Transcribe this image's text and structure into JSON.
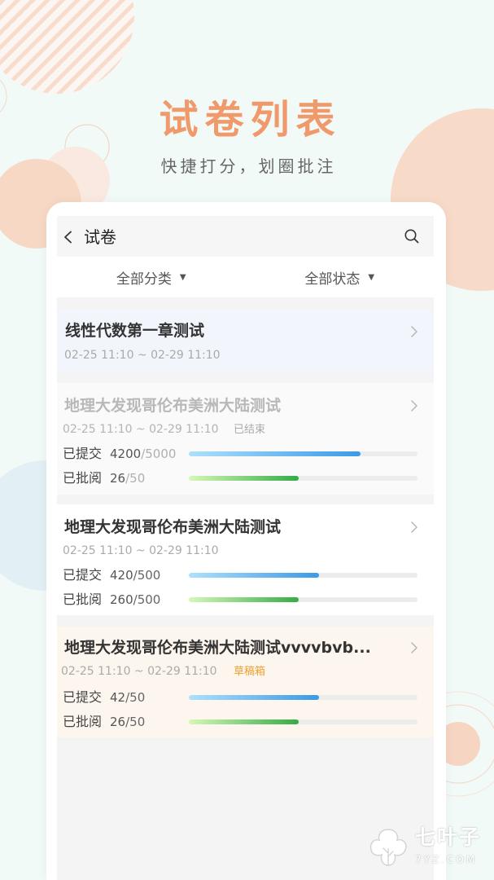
{
  "promo": {
    "title": "试卷列表",
    "subtitle": "快捷打分，划圈批注"
  },
  "header": {
    "back_icon": "chevron-left-icon",
    "title": "试卷",
    "search_icon": "search-icon"
  },
  "filters": {
    "category": {
      "label": "全部分类",
      "caret": "▼"
    },
    "status": {
      "label": "全部状态",
      "caret": "▼"
    }
  },
  "exams": [
    {
      "title": "线性代数第一章测试",
      "date_range": "02-25 11:10 ~ 02-29 11:10",
      "chevron_icon": "chevron-right-icon"
    },
    {
      "title": "地理大发现哥伦布美洲大陆测试",
      "date_range": "02-25 11:10 ~ 02-29 11:10",
      "tag": "已结束",
      "chevron_icon": "chevron-right-icon",
      "submitted": {
        "label": "已提交",
        "done": "4200",
        "total": "/5000",
        "progress": 0.75
      },
      "reviewed": {
        "label": "已批阅",
        "done": "26",
        "total": "/50",
        "progress": 0.48
      }
    },
    {
      "title": "地理大发现哥伦布美洲大陆测试",
      "date_range": "02-25 11:10 ~ 02-29 11:10",
      "chevron_icon": "chevron-right-icon",
      "submitted": {
        "label": "已提交",
        "done": "420",
        "total": "/500",
        "progress": 0.57
      },
      "reviewed": {
        "label": "已批阅",
        "done": "260",
        "total": "/500",
        "progress": 0.48
      }
    },
    {
      "title": "地理大发现哥伦布美洲大陆测试vvvvbvb...",
      "date_range": "02-25 11:10 ~ 02-29 11:10",
      "tag": "草稿箱",
      "chevron_icon": "chevron-right-icon",
      "submitted": {
        "label": "已提交",
        "done": "42",
        "total": "/50",
        "progress": 0.57
      },
      "reviewed": {
        "label": "已批阅",
        "done": "26",
        "total": "/50",
        "progress": 0.48
      }
    }
  ],
  "watermark": {
    "logo_icon": "leaf-logo-icon",
    "brand": "七叶子",
    "site": "7YZ.COM"
  },
  "colors": {
    "page_background": "#f2faf8",
    "promo_title": "#f0996a",
    "accent_peach": "#f6d8c5",
    "draft_tag": "#f0a030",
    "progress_submitted": "#3b9ae8",
    "progress_reviewed": "#34ac46",
    "card_inactive_text": "#b8b8b8"
  }
}
